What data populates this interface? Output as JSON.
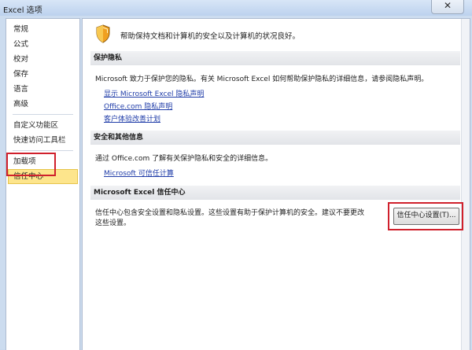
{
  "window": {
    "title": "Excel 选项",
    "close_label": "✕"
  },
  "sidebar": {
    "items": [
      {
        "label": "常规"
      },
      {
        "label": "公式"
      },
      {
        "label": "校对"
      },
      {
        "label": "保存"
      },
      {
        "label": "语言"
      },
      {
        "label": "高级"
      },
      {
        "label": "自定义功能区"
      },
      {
        "label": "快速访问工具栏"
      },
      {
        "label": "加载项"
      },
      {
        "label": "信任中心"
      }
    ],
    "selected": "信任中心"
  },
  "main": {
    "intro_text": "帮助保持文档和计算机的安全以及计算机的状况良好。",
    "privacy": {
      "header": "保护隐私",
      "text": "Microsoft 致力于保护您的隐私。有关 Microsoft Excel 如何帮助保护隐私的详细信息，请参阅隐私声明。",
      "links": [
        "显示 Microsoft Excel 隐私声明",
        "Office.com 隐私声明",
        "客户体验改善计划"
      ]
    },
    "security": {
      "header": "安全和其他信息",
      "text": "通过 Office.com 了解有关保护隐私和安全的详细信息。",
      "link": "Microsoft 可信任计算"
    },
    "trust_center": {
      "header": "Microsoft Excel 信任中心",
      "text_line1": "信任中心包含安全设置和隐私设置。这些设置有助于保护计算机的安全。建议不要更改",
      "text_line2": "这些设置。",
      "button_label": "信任中心设置(T)..."
    }
  },
  "colors": {
    "accent_highlight": "#d0202c",
    "link": "#1f3ca8",
    "selection": "#fde58c"
  }
}
